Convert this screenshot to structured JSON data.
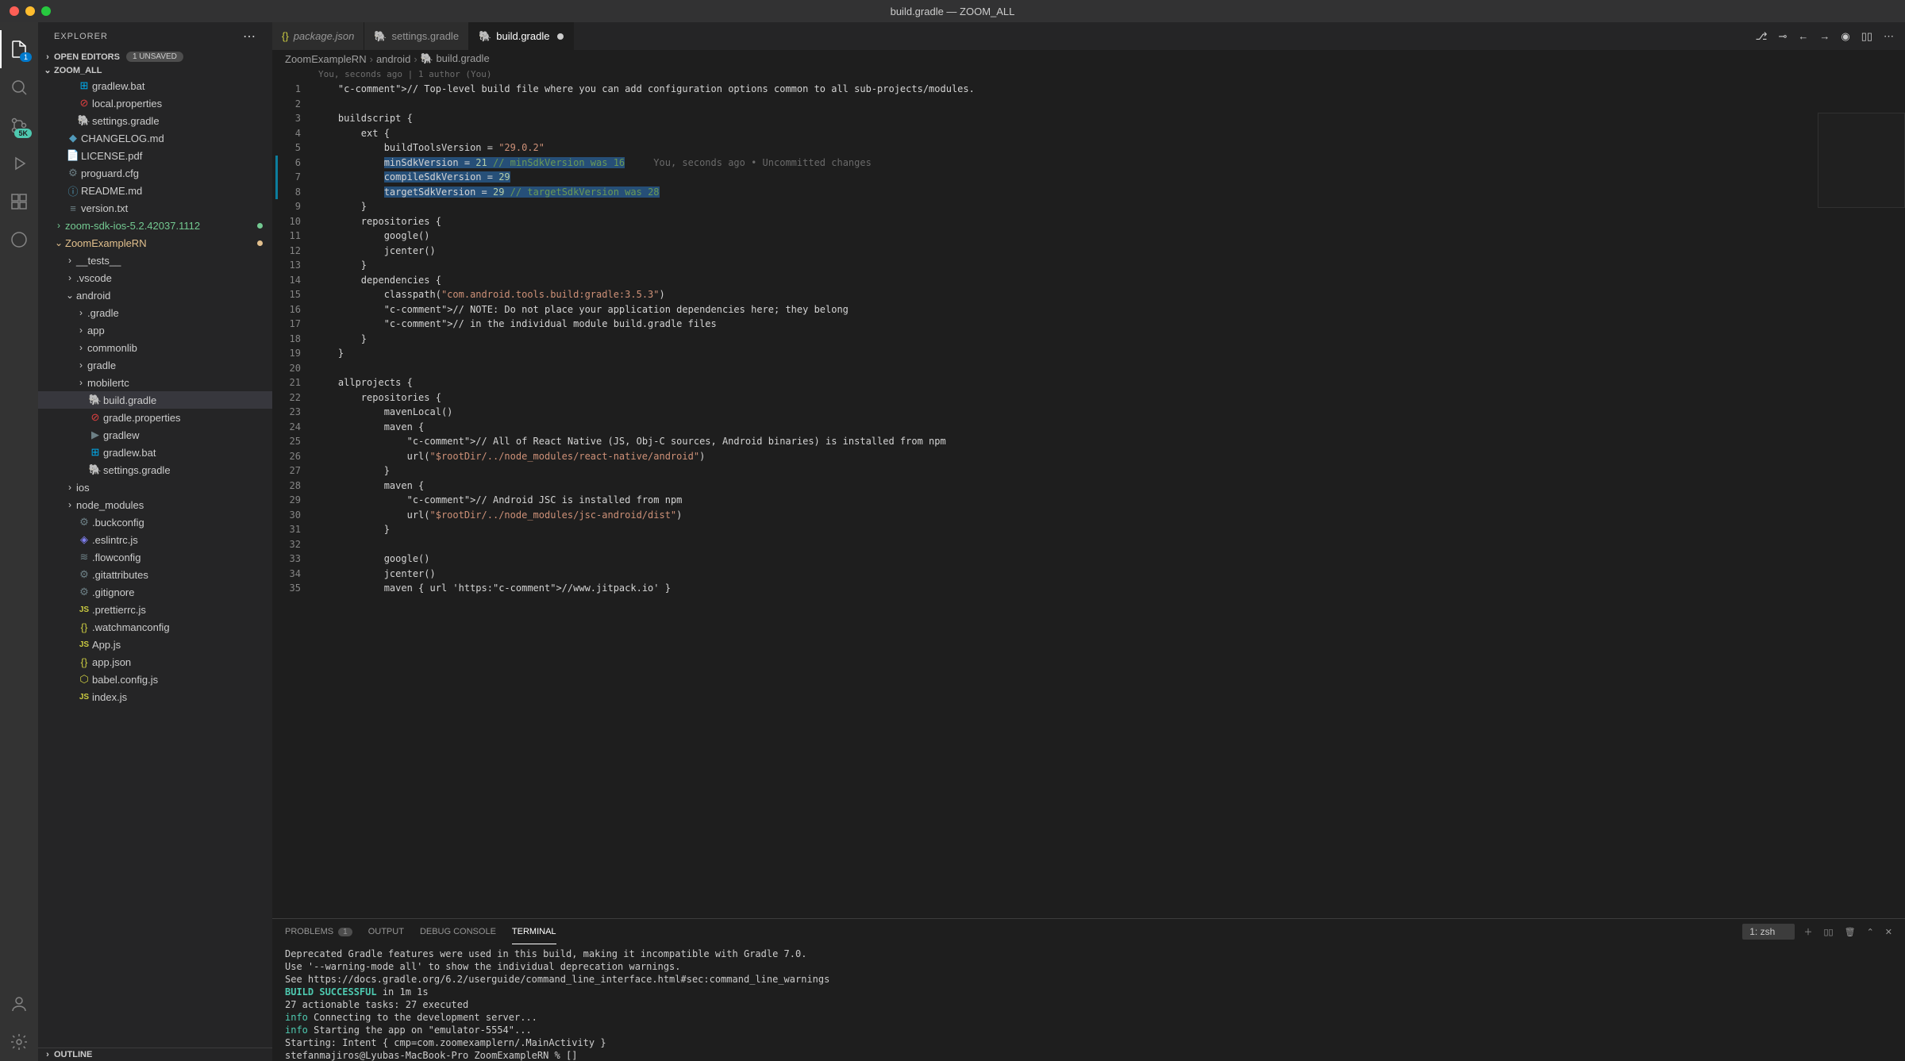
{
  "window": {
    "title": "build.gradle — ZOOM_ALL"
  },
  "sidebar": {
    "title": "EXPLORER",
    "open_editors": {
      "label": "OPEN EDITORS",
      "unsaved": "1 UNSAVED"
    },
    "workspace": "ZOOM_ALL",
    "outline": "OUTLINE"
  },
  "tree": [
    {
      "indent": 2,
      "icon": "win",
      "label": "gradlew.bat"
    },
    {
      "indent": 2,
      "icon": "block",
      "label": "local.properties"
    },
    {
      "indent": 2,
      "icon": "elephant",
      "label": "settings.gradle"
    },
    {
      "indent": 1,
      "icon": "md",
      "label": "CHANGELOG.md"
    },
    {
      "indent": 1,
      "icon": "pdf",
      "label": "LICENSE.pdf"
    },
    {
      "indent": 1,
      "icon": "gear",
      "label": "proguard.cfg"
    },
    {
      "indent": 1,
      "icon": "info",
      "label": "README.md"
    },
    {
      "indent": 1,
      "icon": "txt",
      "label": "version.txt"
    },
    {
      "indent": 1,
      "chev": ">",
      "label": "zoom-sdk-ios-5.2.42037.1112",
      "cls": "green",
      "dot": "#73c991"
    },
    {
      "indent": 1,
      "chev": "v",
      "label": "ZoomExampleRN",
      "cls": "yellow",
      "dot": "#e2c08d"
    },
    {
      "indent": 2,
      "chev": ">",
      "label": "__tests__"
    },
    {
      "indent": 2,
      "chev": ">",
      "label": ".vscode"
    },
    {
      "indent": 2,
      "chev": "v",
      "label": "android"
    },
    {
      "indent": 3,
      "chev": ">",
      "label": ".gradle"
    },
    {
      "indent": 3,
      "chev": ">",
      "label": "app"
    },
    {
      "indent": 3,
      "chev": ">",
      "label": "commonlib"
    },
    {
      "indent": 3,
      "chev": ">",
      "label": "gradle"
    },
    {
      "indent": 3,
      "chev": ">",
      "label": "mobilertc"
    },
    {
      "indent": 3,
      "icon": "elephant",
      "label": "build.gradle",
      "selected": true
    },
    {
      "indent": 3,
      "icon": "block",
      "label": "gradle.properties"
    },
    {
      "indent": 3,
      "icon": "sh",
      "label": "gradlew"
    },
    {
      "indent": 3,
      "icon": "win",
      "label": "gradlew.bat"
    },
    {
      "indent": 3,
      "icon": "elephant",
      "label": "settings.gradle"
    },
    {
      "indent": 2,
      "chev": ">",
      "label": "ios"
    },
    {
      "indent": 2,
      "chev": ">",
      "label": "node_modules"
    },
    {
      "indent": 2,
      "icon": "gear",
      "label": ".buckconfig"
    },
    {
      "indent": 2,
      "icon": "eslint",
      "label": ".eslintrc.js"
    },
    {
      "indent": 2,
      "icon": "flow",
      "label": ".flowconfig"
    },
    {
      "indent": 2,
      "icon": "gear",
      "label": ".gitattributes"
    },
    {
      "indent": 2,
      "icon": "gear",
      "label": ".gitignore"
    },
    {
      "indent": 2,
      "icon": "js",
      "label": ".prettierrc.js"
    },
    {
      "indent": 2,
      "icon": "json",
      "label": ".watchmanconfig"
    },
    {
      "indent": 2,
      "icon": "js",
      "label": "App.js"
    },
    {
      "indent": 2,
      "icon": "json",
      "label": "app.json"
    },
    {
      "indent": 2,
      "icon": "babel",
      "label": "babel.config.js"
    },
    {
      "indent": 2,
      "icon": "js",
      "label": "index.js"
    }
  ],
  "tabs": [
    {
      "icon": "json",
      "label": "package.json",
      "italic": true
    },
    {
      "icon": "elephant",
      "label": "settings.gradle"
    },
    {
      "icon": "elephant",
      "label": "build.gradle",
      "active": true,
      "dirty": true
    }
  ],
  "breadcrumb": [
    "ZoomExampleRN",
    "android",
    "build.gradle"
  ],
  "blame": "You, seconds ago | 1 author (You)",
  "inline_blame": "You, seconds ago • Uncommitted changes",
  "code_lines": [
    "    // Top-level build file where you can add configuration options common to all sub-projects/modules.",
    "",
    "    buildscript {",
    "        ext {",
    "            buildToolsVersion = \"29.0.2\"",
    "            minSdkVersion = 21 // minSdkVersion was 16",
    "            compileSdkVersion = 29",
    "            targetSdkVersion = 29 // targetSdkVersion was 28",
    "        }",
    "        repositories {",
    "            google()",
    "            jcenter()",
    "        }",
    "        dependencies {",
    "            classpath(\"com.android.tools.build:gradle:3.5.3\")",
    "            // NOTE: Do not place your application dependencies here; they belong",
    "            // in the individual module build.gradle files",
    "        }",
    "    }",
    "",
    "    allprojects {",
    "        repositories {",
    "            mavenLocal()",
    "            maven {",
    "                // All of React Native (JS, Obj-C sources, Android binaries) is installed from npm",
    "                url(\"$rootDir/../node_modules/react-native/android\")",
    "            }",
    "            maven {",
    "                // Android JSC is installed from npm",
    "                url(\"$rootDir/../node_modules/jsc-android/dist\")",
    "            }",
    "",
    "            google()",
    "            jcenter()",
    "            maven { url 'https://www.jitpack.io' }"
  ],
  "panel": {
    "tabs": [
      "PROBLEMS",
      "OUTPUT",
      "DEBUG CONSOLE",
      "TERMINAL"
    ],
    "problems_badge": "1",
    "active": "TERMINAL",
    "term_select": "1: zsh"
  },
  "terminal": [
    "Deprecated Gradle features were used in this build, making it incompatible with Gradle 7.0.",
    "Use '--warning-mode all' to show the individual deprecation warnings.",
    "See https://docs.gradle.org/6.2/userguide/command_line_interface.html#sec:command_line_warnings",
    "",
    "BUILD SUCCESSFUL in 1m 1s",
    "27 actionable tasks: 27 executed",
    "info Connecting to the development server...",
    "info Starting the app on \"emulator-5554\"...",
    "Starting: Intent { cmp=com.zoomexamplern/.MainActivity }",
    "stefanmajiros@Lyubas-MacBook-Pro ZoomExampleRN % []"
  ]
}
